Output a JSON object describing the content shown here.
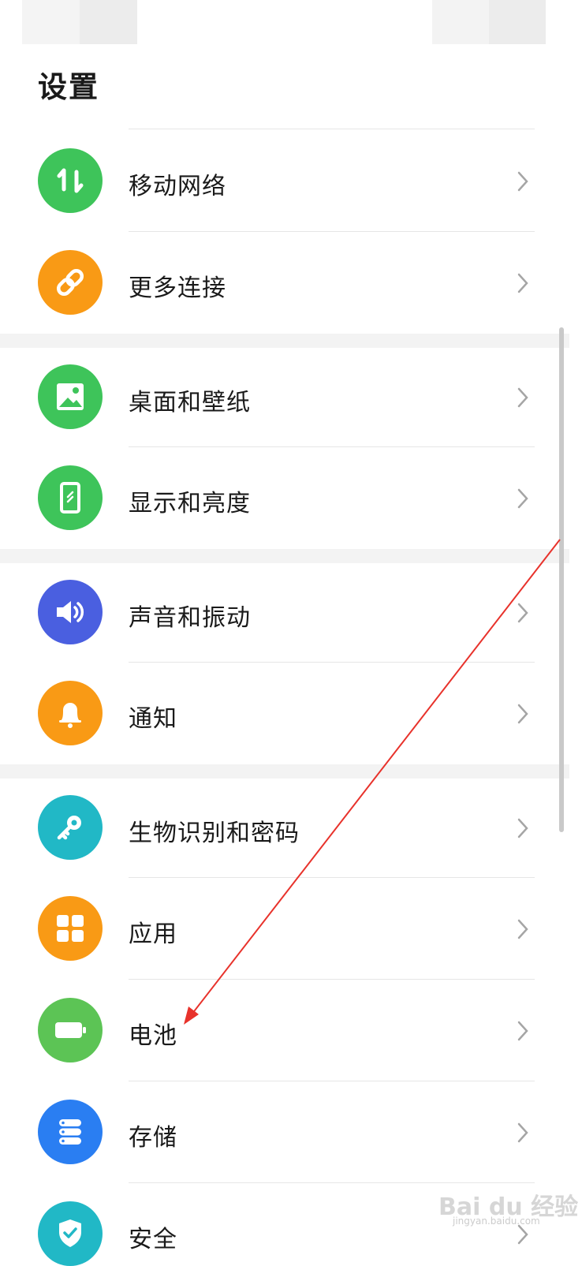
{
  "header": {
    "title": "设置"
  },
  "items": [
    {
      "label": "移动网络",
      "icon": "mobile-data-icon",
      "color": "#3ec45a"
    },
    {
      "label": "更多连接",
      "icon": "link-icon",
      "color": "#f99a15"
    },
    {
      "label": "桌面和壁纸",
      "icon": "image-icon",
      "color": "#3ec45a"
    },
    {
      "label": "显示和亮度",
      "icon": "phone-display-icon",
      "color": "#3ec45a"
    },
    {
      "label": "声音和振动",
      "icon": "speaker-icon",
      "color": "#4a5fe0"
    },
    {
      "label": "通知",
      "icon": "bell-icon",
      "color": "#f99a15"
    },
    {
      "label": "生物识别和密码",
      "icon": "key-icon",
      "color": "#21b8c6"
    },
    {
      "label": "应用",
      "icon": "apps-grid-icon",
      "color": "#f99a15"
    },
    {
      "label": "电池",
      "icon": "battery-icon",
      "color": "#5cc455"
    },
    {
      "label": "存储",
      "icon": "storage-icon",
      "color": "#2a7ef2"
    },
    {
      "label": "安全",
      "icon": "shield-icon",
      "color": "#21b8c6"
    }
  ],
  "watermark": {
    "text": "Bai du 经验",
    "sub": "jingyan.baidu.com"
  },
  "annotation": {
    "arrow_color": "#e8322b"
  }
}
